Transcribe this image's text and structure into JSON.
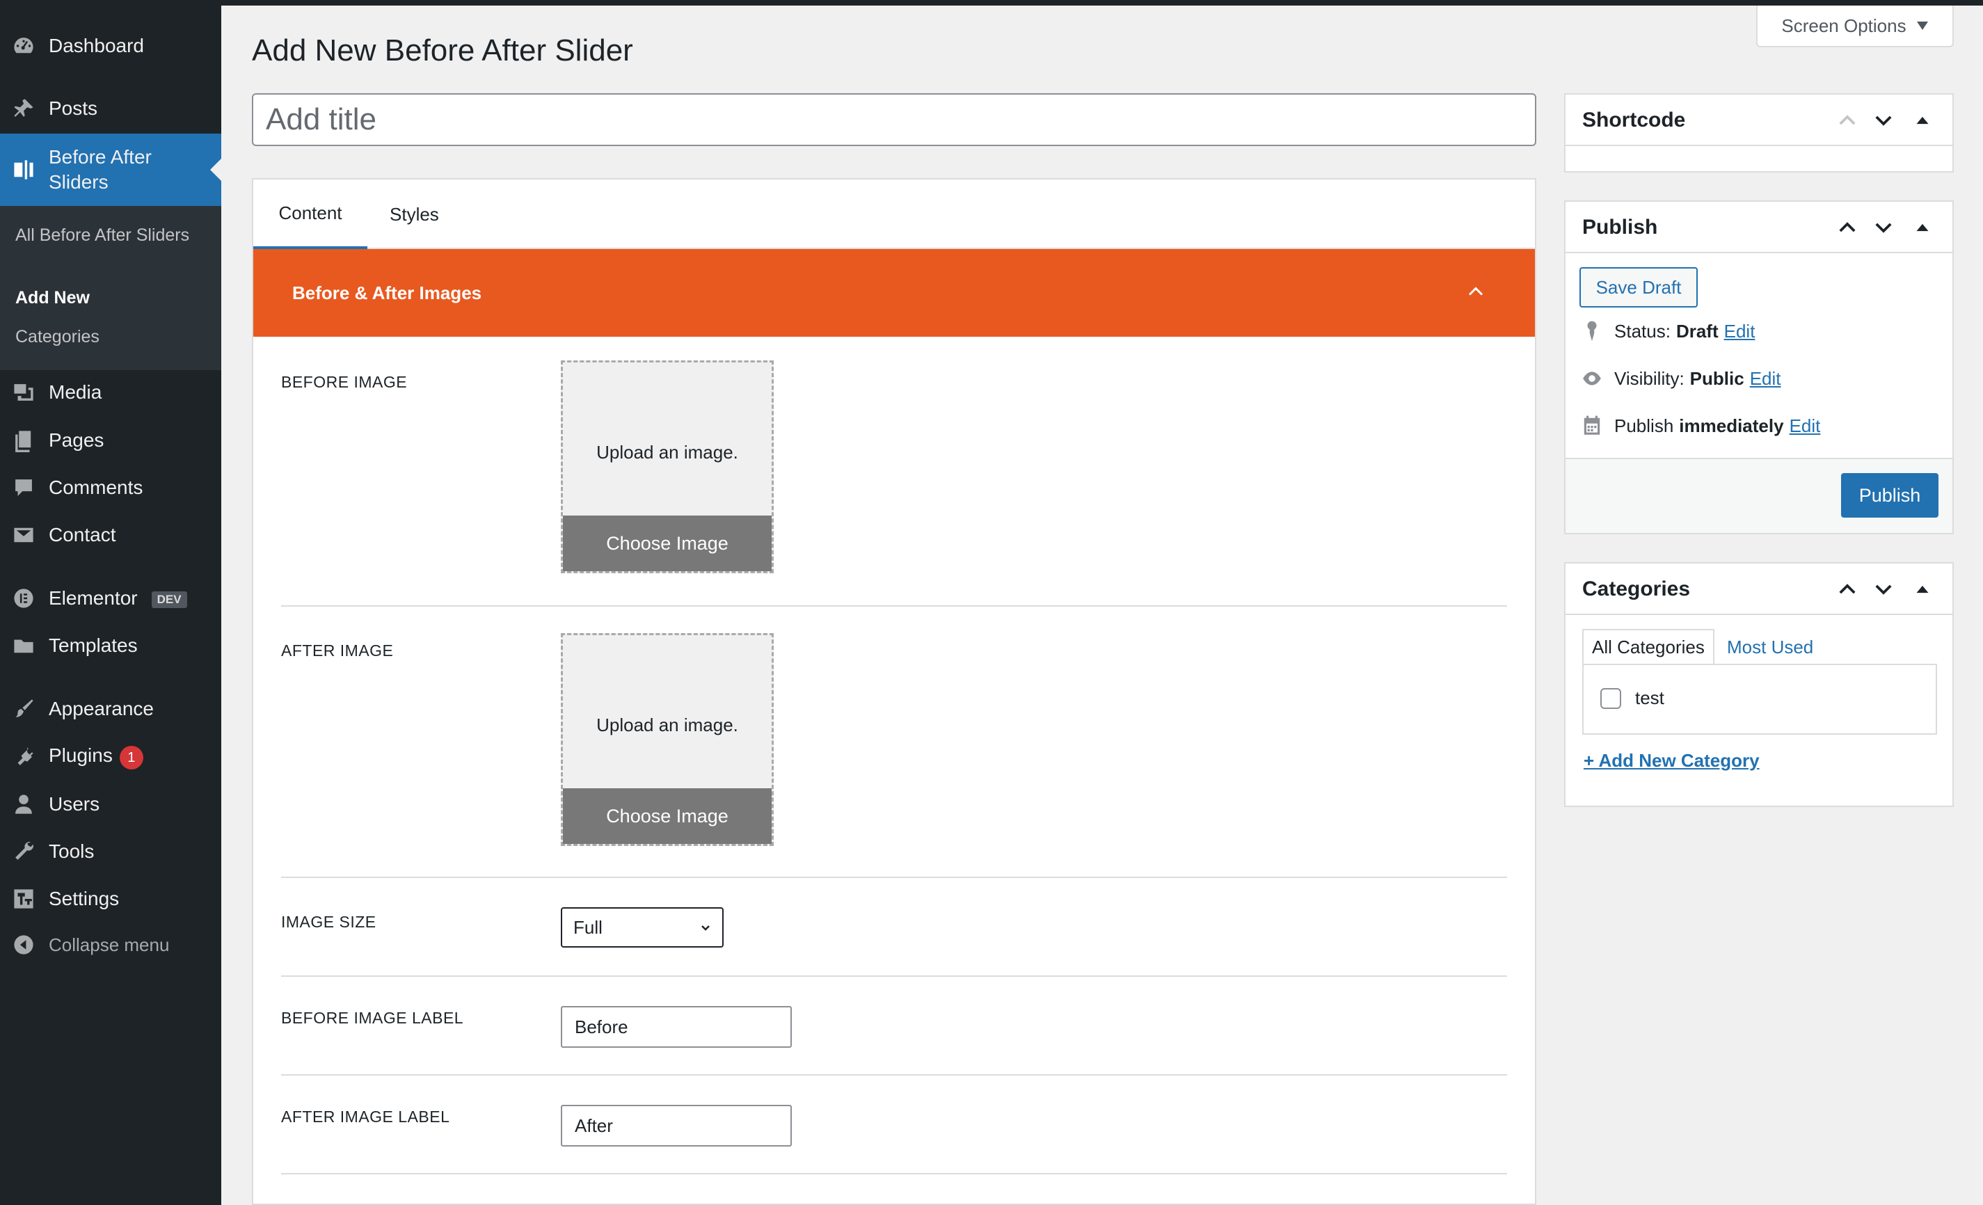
{
  "sidebar": {
    "items": {
      "dashboard": "Dashboard",
      "posts": "Posts",
      "before_after": "Before After Sliders",
      "media": "Media",
      "pages": "Pages",
      "comments": "Comments",
      "contact": "Contact",
      "elementor": "Elementor",
      "elementor_tag": "DEV",
      "templates": "Templates",
      "appearance": "Appearance",
      "plugins": "Plugins",
      "plugins_badge": "1",
      "users": "Users",
      "tools": "Tools",
      "settings": "Settings",
      "collapse": "Collapse menu"
    },
    "submenu": {
      "all": "All Before After Sliders",
      "add_new": "Add New",
      "categories": "Categories"
    }
  },
  "header": {
    "screen_options": "Screen Options",
    "page_title": "Add New Before After Slider"
  },
  "title_field": {
    "placeholder": "Add title",
    "value": ""
  },
  "main": {
    "tabs": {
      "content": "Content",
      "styles": "Styles"
    },
    "section_title": "Before & After Images",
    "before_image": {
      "label": "BEFORE IMAGE",
      "upload_text": "Upload an image.",
      "button": "Choose Image"
    },
    "after_image": {
      "label": "AFTER IMAGE",
      "upload_text": "Upload an image.",
      "button": "Choose Image"
    },
    "image_size": {
      "label": "IMAGE SIZE",
      "selected": "Full"
    },
    "before_label": {
      "label": "BEFORE IMAGE LABEL",
      "value": "Before"
    },
    "after_label": {
      "label": "AFTER IMAGE LABEL",
      "value": "After"
    }
  },
  "shortcode_box": {
    "title": "Shortcode"
  },
  "publish_box": {
    "title": "Publish",
    "save_draft": "Save Draft",
    "status_label": "Status:",
    "status_value": "Draft",
    "visibility_label": "Visibility:",
    "visibility_value": "Public",
    "publish_label": "Publish",
    "publish_value": "immediately",
    "edit": "Edit",
    "publish_button": "Publish"
  },
  "categories_box": {
    "title": "Categories",
    "tab_all": "All Categories",
    "tab_most_used": "Most Used",
    "items": [
      "test"
    ],
    "add_new": "+ Add New Category"
  },
  "colors": {
    "sidebar_bg": "#1d2327",
    "accent": "#2271b1",
    "section_header": "#e8591f",
    "badge": "#d63638"
  },
  "icons": {
    "dashboard": "dashboard-icon",
    "posts": "pin-icon",
    "before_after": "slider-icon",
    "media": "media-icon",
    "pages": "pages-icon",
    "comments": "comment-icon",
    "contact": "envelope-icon",
    "elementor": "elementor-icon",
    "templates": "folder-icon",
    "appearance": "brush-icon",
    "plugins": "plug-icon",
    "users": "user-icon",
    "tools": "wrench-icon",
    "settings": "settings-icon",
    "collapse": "collapse-icon"
  }
}
